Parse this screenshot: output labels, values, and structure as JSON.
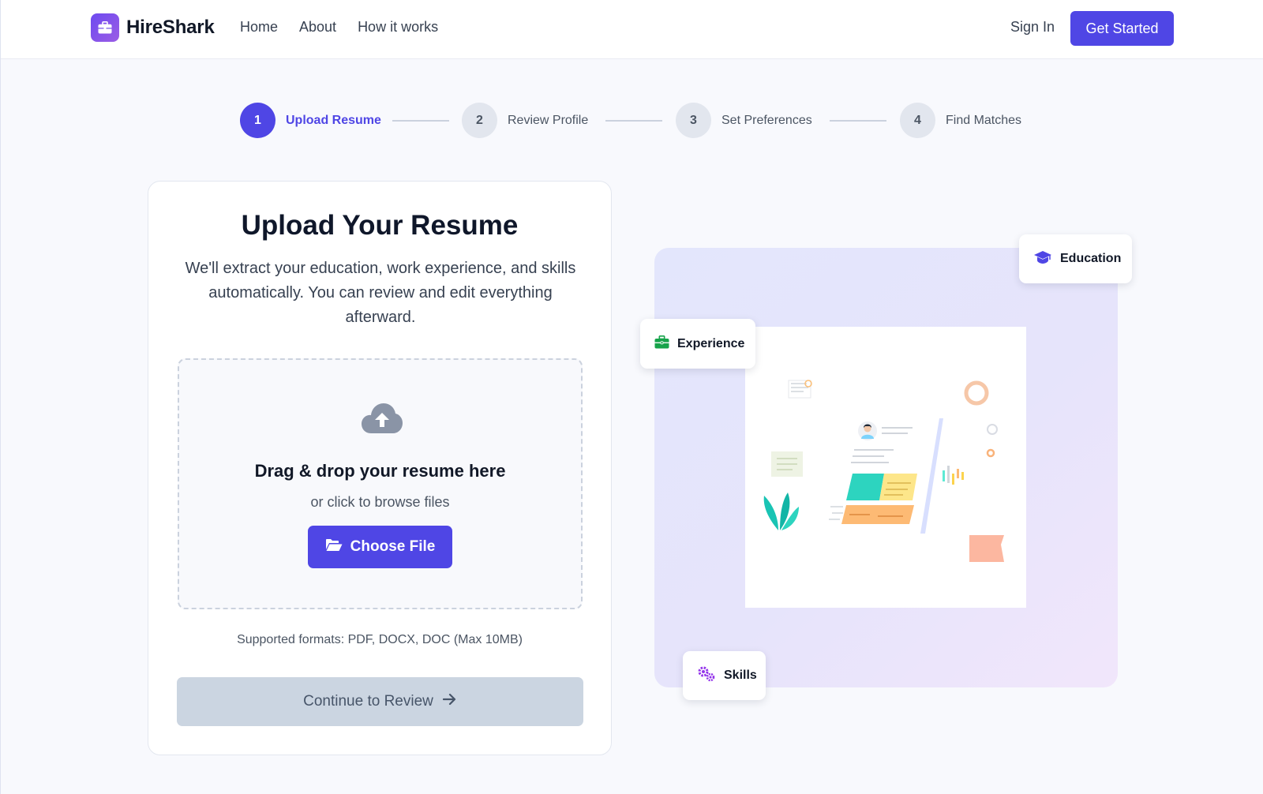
{
  "header": {
    "logo_text": "HireShark",
    "nav": [
      "Home",
      "About",
      "How it works"
    ],
    "sign_in": "Sign In",
    "get_started": "Get Started"
  },
  "stepper": {
    "current_step": 1,
    "steps": [
      {
        "number": "1",
        "label": "Upload Resume"
      },
      {
        "number": "2",
        "label": "Review Profile"
      },
      {
        "number": "3",
        "label": "Set Preferences"
      },
      {
        "number": "4",
        "label": "Find Matches"
      }
    ]
  },
  "upload_card": {
    "title": "Upload Your Resume",
    "description": "We'll extract your education, work experience, and skills automatically. You can review and edit everything afterward.",
    "dropzone_title": "Drag & drop your resume here",
    "dropzone_subtitle": "or click to browse files",
    "choose_file": "Choose File",
    "formats": "Supported formats: PDF, DOCX, DOC (Max 10MB)",
    "continue": "Continue to Review"
  },
  "illustration": {
    "chips": {
      "education": "Education",
      "experience": "Experience",
      "skills": "Skills"
    }
  },
  "icons": {
    "logo": "briefcase-icon",
    "dropzone": "cloud-upload-icon",
    "choose_file": "folder-open-icon",
    "continue": "arrow-right-icon",
    "education": "graduation-cap-icon",
    "experience": "briefcase-icon",
    "skills": "gears-icon"
  },
  "colors": {
    "primary": "#4f46e5",
    "disabled_button": "#cbd5e1",
    "experience_icon": "#16a34a",
    "skills_icon": "#9333ea"
  }
}
